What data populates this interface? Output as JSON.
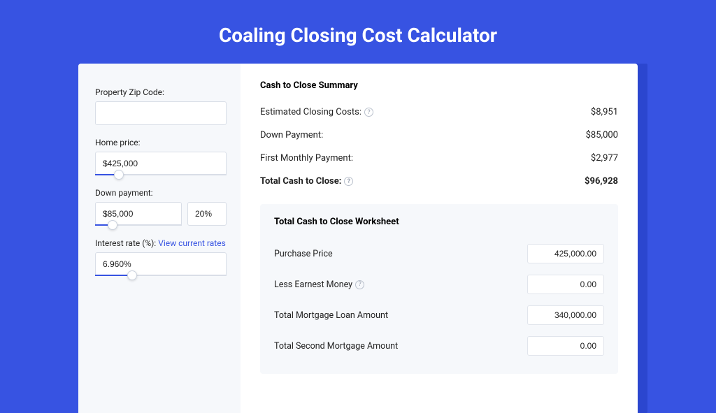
{
  "title": "Coaling Closing Cost Calculator",
  "left": {
    "zip_label": "Property Zip Code:",
    "zip_value": "",
    "home_price_label": "Home price:",
    "home_price_value": "$425,000",
    "home_price_slider_pct": 18,
    "down_payment_label": "Down payment:",
    "down_payment_value": "$85,000",
    "down_payment_pct_value": "20%",
    "down_payment_slider_pct": 20,
    "interest_label_prefix": "Interest rate (%): ",
    "interest_link_text": "View current rates",
    "interest_value": "6.960%",
    "interest_slider_pct": 28
  },
  "summary": {
    "title": "Cash to Close Summary",
    "rows": [
      {
        "label": "Estimated Closing Costs:",
        "help": true,
        "value": "$8,951",
        "bold": false
      },
      {
        "label": "Down Payment:",
        "help": false,
        "value": "$85,000",
        "bold": false
      },
      {
        "label": "First Monthly Payment:",
        "help": false,
        "value": "$2,977",
        "bold": false
      },
      {
        "label": "Total Cash to Close:",
        "help": true,
        "value": "$96,928",
        "bold": true
      }
    ]
  },
  "worksheet": {
    "title": "Total Cash to Close Worksheet",
    "rows": [
      {
        "label": "Purchase Price",
        "help": false,
        "value": "425,000.00"
      },
      {
        "label": "Less Earnest Money",
        "help": true,
        "value": "0.00"
      },
      {
        "label": "Total Mortgage Loan Amount",
        "help": false,
        "value": "340,000.00"
      },
      {
        "label": "Total Second Mortgage Amount",
        "help": false,
        "value": "0.00"
      }
    ]
  }
}
